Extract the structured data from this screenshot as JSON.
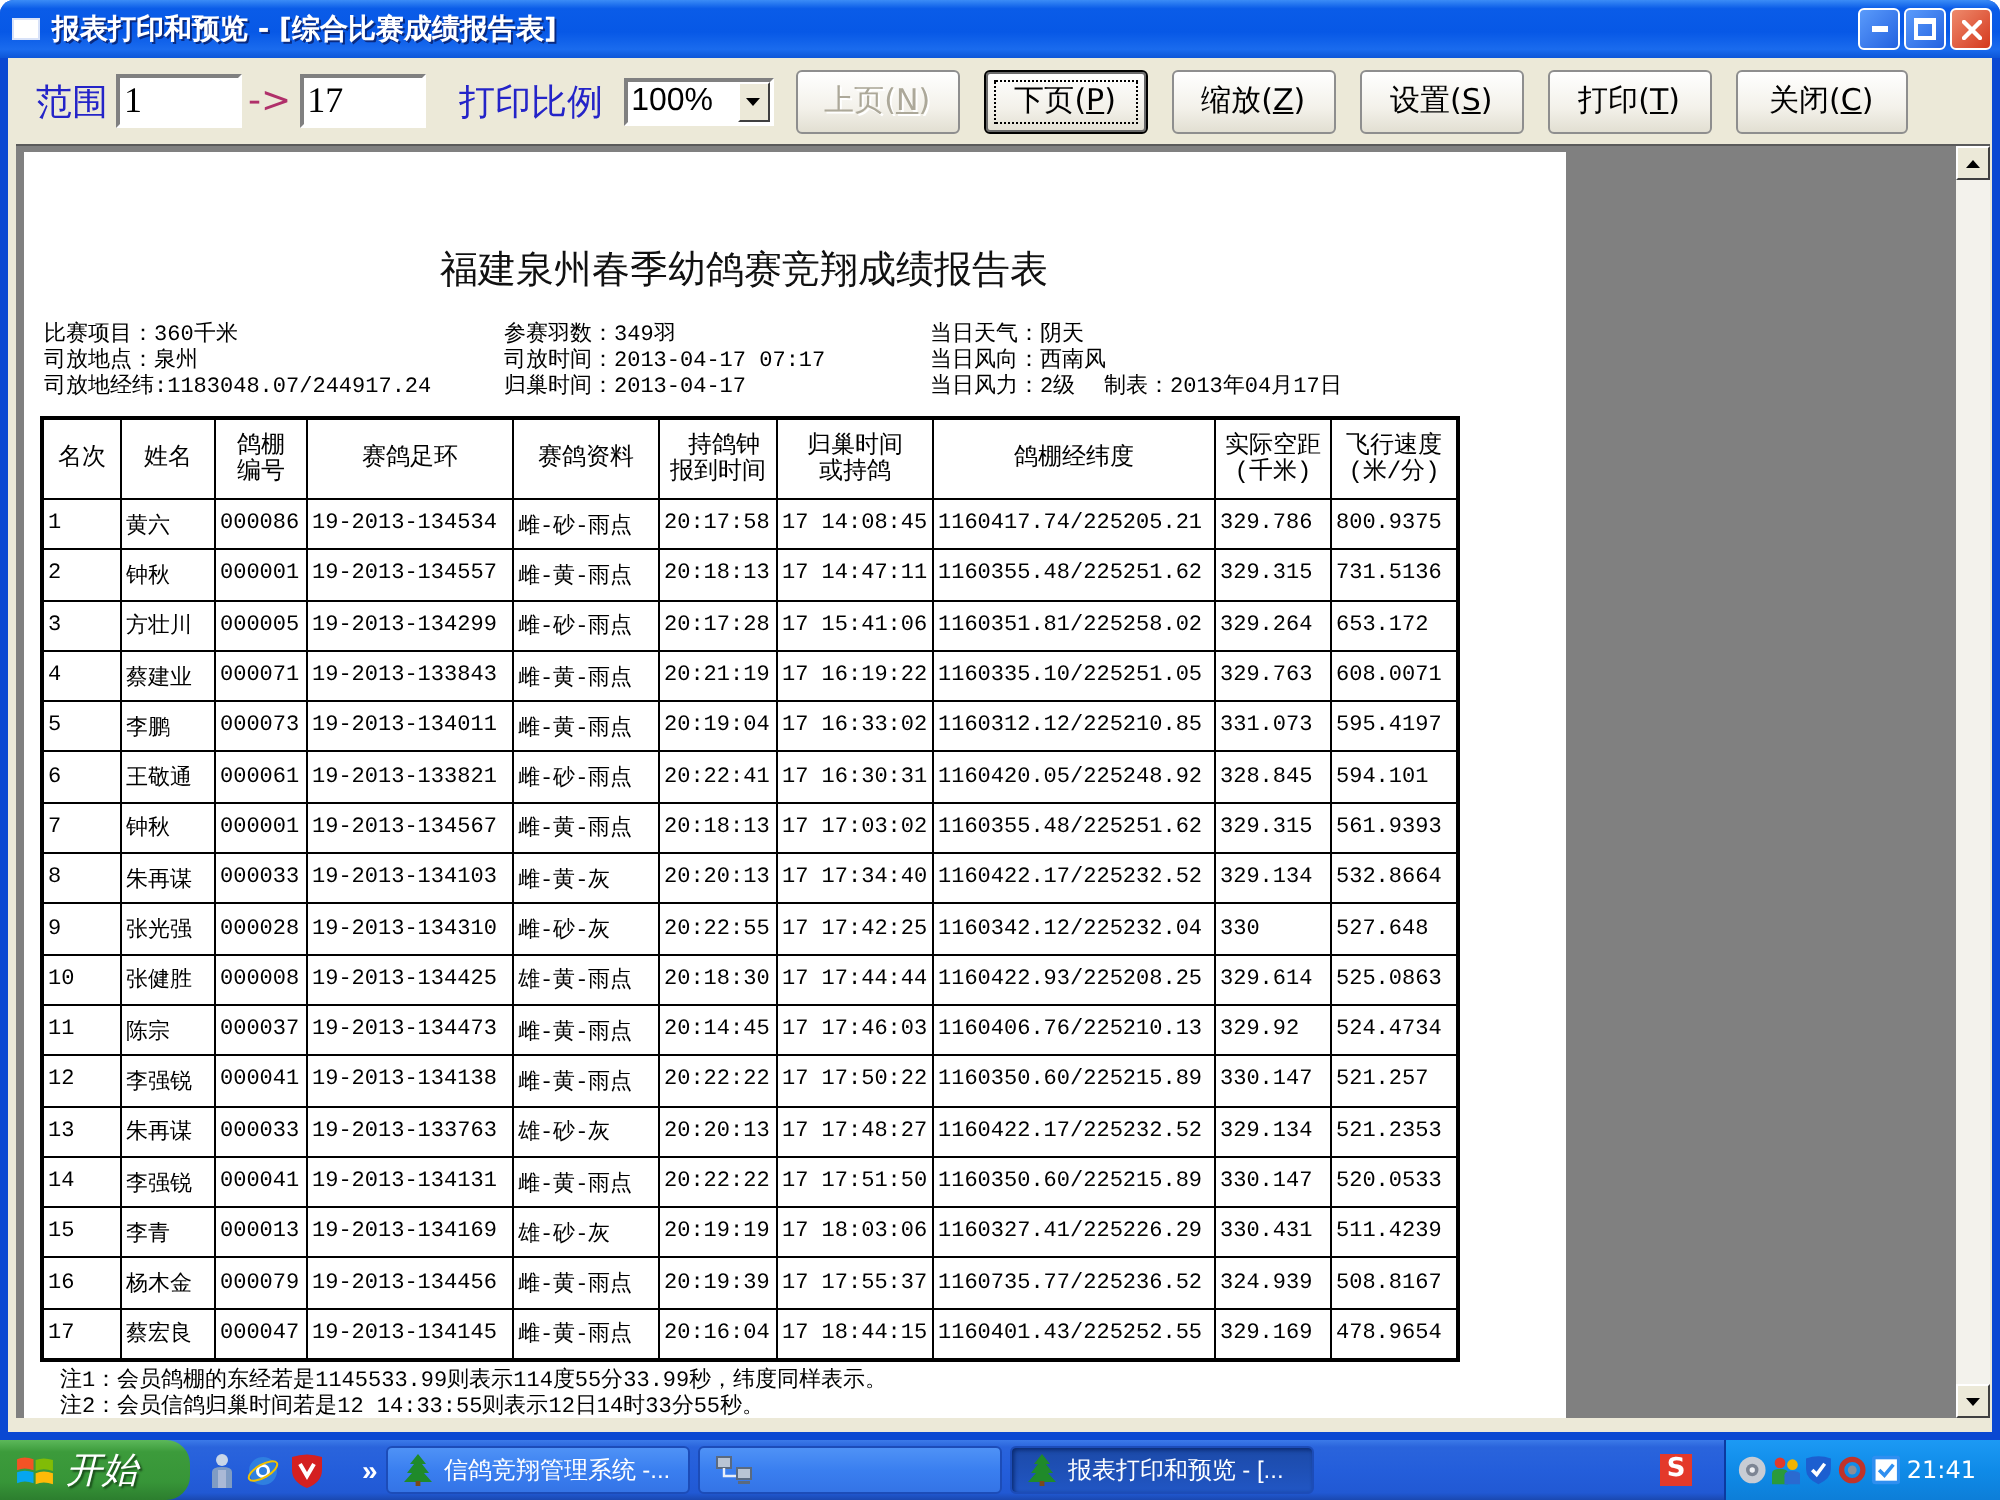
{
  "window": {
    "title": "报表打印和预览 - [综合比赛成绩报告表]"
  },
  "toolbar": {
    "range_label": "范围",
    "range_from": "1",
    "range_separator": "->",
    "range_to": "17",
    "scale_label": "打印比例",
    "scale_value": "100%",
    "buttons": [
      {
        "prefix": "上页(",
        "key": "N",
        "suffix": ")",
        "disabled": true,
        "focused": false
      },
      {
        "prefix": "下页(",
        "key": "P",
        "suffix": ")",
        "disabled": false,
        "focused": true
      },
      {
        "prefix": "缩放(",
        "key": "Z",
        "suffix": ")",
        "disabled": false,
        "focused": false
      },
      {
        "prefix": "设置(",
        "key": "S",
        "suffix": ")",
        "disabled": false,
        "focused": false
      },
      {
        "prefix": "打印(",
        "key": "T",
        "suffix": ")",
        "disabled": false,
        "focused": false
      },
      {
        "prefix": "关闭(",
        "key": "C",
        "suffix": ")",
        "disabled": false,
        "focused": false
      }
    ]
  },
  "report": {
    "title": "福建泉州春季幼鸽赛竞翔成绩报告表",
    "info_columns": [
      [
        "比赛项目：360千米",
        "司放地点：泉州",
        "司放地经纬:1183048.07/244917.24"
      ],
      [
        "参赛羽数：349羽",
        "司放时间：2013-04-17 07:17",
        "归巢时间：2013-04-17"
      ],
      [
        "当日天气：阴天",
        "当日风向：西南风",
        "当日风力：2级"
      ]
    ],
    "prepared": "制表：2013年04月17日",
    "table": {
      "columns": [
        "名次",
        "姓名",
        "鸽棚编号",
        "赛鸽足环",
        "赛鸽资料",
        "持鸽钟报到时间",
        "归巢时间或持鸽",
        "鸽棚经纬度",
        "实际空距\n(千米)",
        "飞行速度\n(米/分)"
      ],
      "rows": [
        [
          "1",
          "黄六",
          "000086",
          "19-2013-134534",
          "雌-砂-雨点",
          "20:17:58",
          "17 14:08:45",
          "1160417.74/225205.21",
          "329.786",
          "800.9375"
        ],
        [
          "2",
          "钟秋",
          "000001",
          "19-2013-134557",
          "雌-黄-雨点",
          "20:18:13",
          "17 14:47:11",
          "1160355.48/225251.62",
          "329.315",
          "731.5136"
        ],
        [
          "3",
          "方壮川",
          "000005",
          "19-2013-134299",
          "雌-砂-雨点",
          "20:17:28",
          "17 15:41:06",
          "1160351.81/225258.02",
          "329.264",
          "653.172"
        ],
        [
          "4",
          "蔡建业",
          "000071",
          "19-2013-133843",
          "雌-黄-雨点",
          "20:21:19",
          "17 16:19:22",
          "1160335.10/225251.05",
          "329.763",
          "608.0071"
        ],
        [
          "5",
          "李鹏",
          "000073",
          "19-2013-134011",
          "雌-黄-雨点",
          "20:19:04",
          "17 16:33:02",
          "1160312.12/225210.85",
          "331.073",
          "595.4197"
        ],
        [
          "6",
          "王敬通",
          "000061",
          "19-2013-133821",
          "雌-砂-雨点",
          "20:22:41",
          "17 16:30:31",
          "1160420.05/225248.92",
          "328.845",
          "594.101"
        ],
        [
          "7",
          "钟秋",
          "000001",
          "19-2013-134567",
          "雌-黄-雨点",
          "20:18:13",
          "17 17:03:02",
          "1160355.48/225251.62",
          "329.315",
          "561.9393"
        ],
        [
          "8",
          "朱再谋",
          "000033",
          "19-2013-134103",
          "雌-黄-灰",
          "20:20:13",
          "17 17:34:40",
          "1160422.17/225232.52",
          "329.134",
          "532.8664"
        ],
        [
          "9",
          "张光强",
          "000028",
          "19-2013-134310",
          "雌-砂-灰",
          "20:22:55",
          "17 17:42:25",
          "1160342.12/225232.04",
          "330",
          "527.648"
        ],
        [
          "10",
          "张健胜",
          "000008",
          "19-2013-134425",
          "雄-黄-雨点",
          "20:18:30",
          "17 17:44:44",
          "1160422.93/225208.25",
          "329.614",
          "525.0863"
        ],
        [
          "11",
          "陈宗",
          "000037",
          "19-2013-134473",
          "雌-黄-雨点",
          "20:14:45",
          "17 17:46:03",
          "1160406.76/225210.13",
          "329.92",
          "524.4734"
        ],
        [
          "12",
          "李强锐",
          "000041",
          "19-2013-134138",
          "雌-黄-雨点",
          "20:22:22",
          "17 17:50:22",
          "1160350.60/225215.89",
          "330.147",
          "521.257"
        ],
        [
          "13",
          "朱再谋",
          "000033",
          "19-2013-133763",
          "雄-砂-灰",
          "20:20:13",
          "17 17:48:27",
          "1160422.17/225232.52",
          "329.134",
          "521.2353"
        ],
        [
          "14",
          "李强锐",
          "000041",
          "19-2013-134131",
          "雌-黄-雨点",
          "20:22:22",
          "17 17:51:50",
          "1160350.60/225215.89",
          "330.147",
          "520.0533"
        ],
        [
          "15",
          "李青",
          "000013",
          "19-2013-134169",
          "雄-砂-灰",
          "20:19:19",
          "17 18:03:06",
          "1160327.41/225226.29",
          "330.431",
          "511.4239"
        ],
        [
          "16",
          "杨木金",
          "000079",
          "19-2013-134456",
          "雌-黄-雨点",
          "20:19:39",
          "17 17:55:37",
          "1160735.77/225236.52",
          "324.939",
          "508.8167"
        ],
        [
          "17",
          "蔡宏良",
          "000047",
          "19-2013-134145",
          "雌-黄-雨点",
          "20:16:04",
          "17 18:44:15",
          "1160401.43/225252.55",
          "329.169",
          "478.9654"
        ]
      ]
    },
    "notes": [
      "注1：会员鸽棚的东经若是1145533.99则表示114度55分33.99秒，纬度同样表示。",
      "注2：会员信鸽归巢时间若是12 14:33:55则表示12日14时33分55秒。"
    ]
  },
  "taskbar": {
    "start_label": "开始",
    "more": "»",
    "tasks": [
      {
        "kind": "tree",
        "label": "信鸽竞翔管理系统 -...",
        "selected": false
      },
      {
        "kind": "network",
        "selected": false
      },
      {
        "kind": "tree",
        "label": "报表打印和预览 - [...",
        "selected": true
      }
    ],
    "ime": "S",
    "clock": "21:41"
  }
}
